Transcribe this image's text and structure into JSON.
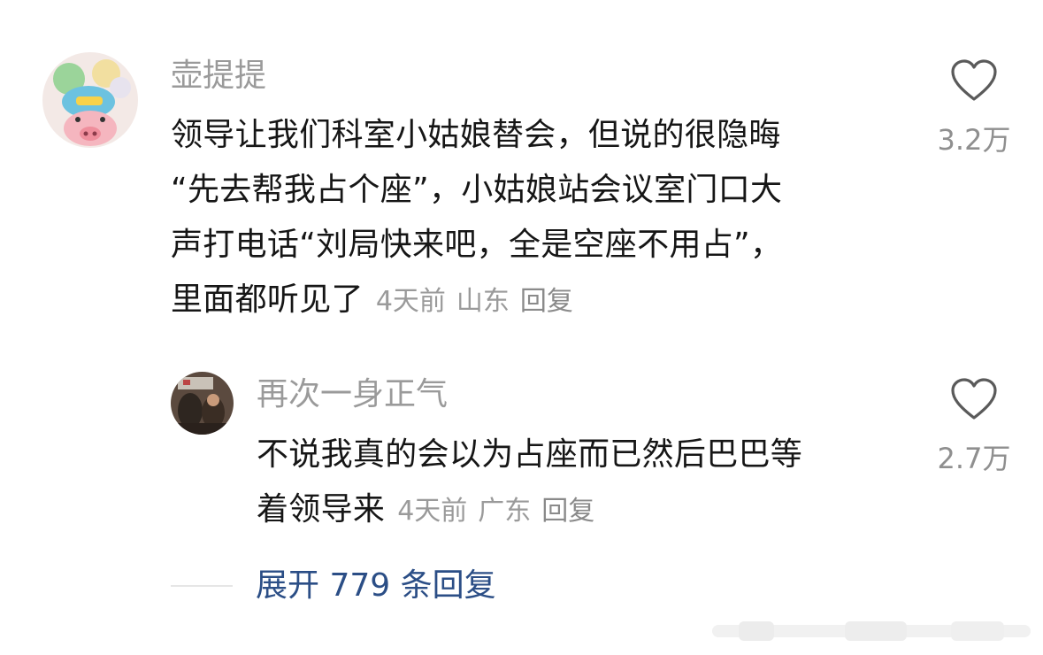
{
  "comments": [
    {
      "username": "壶提提",
      "lines": [
        "领导让我们科室小姑娘替会，但说的很隐晦",
        "“先去帮我占个座”，小姑娘站会议室门口大",
        "声打电话“刘局快来吧，全是空座不用占”，",
        "里面都听见了"
      ],
      "time": "4天前",
      "location": "山东",
      "reply_label": "回复",
      "like_count": "3.2万"
    },
    {
      "username": "再次一身正气",
      "lines": [
        "不说我真的会以为占座而已然后巴巴等",
        "着领导来"
      ],
      "time": "4天前",
      "location": "广东",
      "reply_label": "回复",
      "like_count": "2.7万"
    }
  ],
  "expand": {
    "label": "展开 779 条回复"
  },
  "colors": {
    "link": "#2b4e86",
    "meta": "#9a9a9a",
    "body": "#161616"
  },
  "icons": [
    "heart-outline-icon"
  ]
}
